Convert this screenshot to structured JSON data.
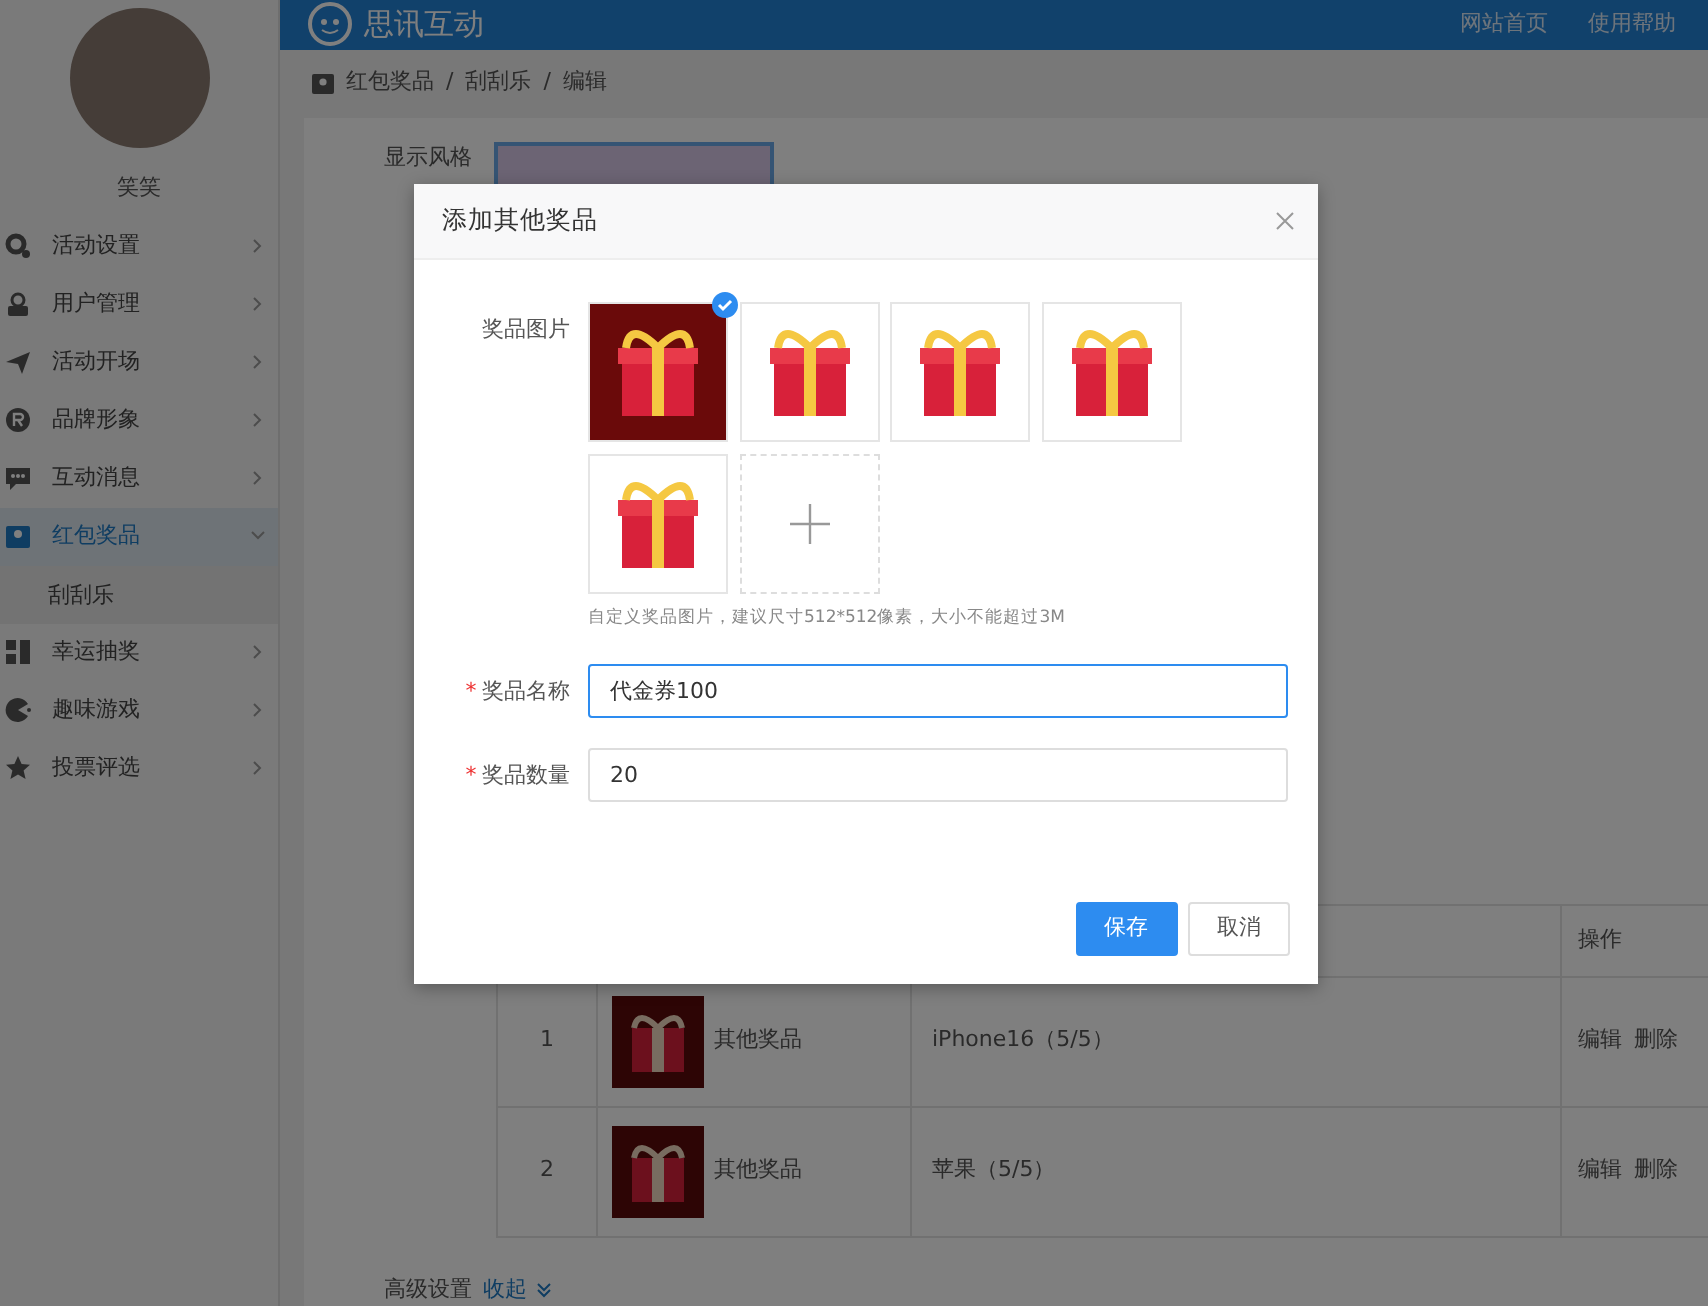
{
  "header": {
    "brand": "思讯互动",
    "links": [
      "网站首页",
      "使用帮助"
    ]
  },
  "sidebar": {
    "user_name": "笑笑",
    "items": [
      {
        "label": "活动设置",
        "selected": false,
        "expanded": false
      },
      {
        "label": "用户管理",
        "selected": false,
        "expanded": false
      },
      {
        "label": "活动开场",
        "selected": false,
        "expanded": false
      },
      {
        "label": "品牌形象",
        "selected": false,
        "expanded": false
      },
      {
        "label": "互动消息",
        "selected": false,
        "expanded": false
      },
      {
        "label": "红包奖品",
        "selected": true,
        "expanded": true,
        "children": [
          {
            "label": "刮刮乐"
          }
        ]
      },
      {
        "label": "幸运抽奖",
        "selected": false,
        "expanded": false
      },
      {
        "label": "趣味游戏",
        "selected": false,
        "expanded": false
      },
      {
        "label": "投票评选",
        "selected": false,
        "expanded": false
      }
    ]
  },
  "breadcrumb": {
    "separator": "/",
    "items": [
      "红包奖品",
      "刮刮乐",
      "编辑"
    ]
  },
  "form": {
    "style_label": "显示风格"
  },
  "table": {
    "columns": [
      "操作"
    ],
    "rows": [
      {
        "index": "1",
        "prize": "其他奖品",
        "name": "iPhone16（5/5）",
        "actions": [
          "编辑",
          "删除"
        ]
      },
      {
        "index": "2",
        "prize": "其他奖品",
        "name": "苹果（5/5）",
        "actions": [
          "编辑",
          "删除"
        ]
      }
    ]
  },
  "advanced": {
    "label": "高级设置",
    "toggle": "收起"
  },
  "modal": {
    "title": "添加其他奖品",
    "image_label": "奖品图片",
    "images": [
      {
        "selected": true
      },
      {
        "selected": false
      },
      {
        "selected": false
      },
      {
        "selected": false
      },
      {
        "selected": false
      }
    ],
    "hint": "自定义奖品图片，建议尺寸512*512像素，大小不能超过3M",
    "fields": [
      {
        "mark": "*",
        "label": "奖品名称",
        "value": "代金券100",
        "focused": true
      },
      {
        "mark": "*",
        "label": "奖品数量",
        "value": "20",
        "focused": false
      }
    ],
    "buttons": [
      {
        "label": "保存",
        "kind": "primary"
      },
      {
        "label": "取消",
        "kind": "secondary"
      }
    ]
  }
}
